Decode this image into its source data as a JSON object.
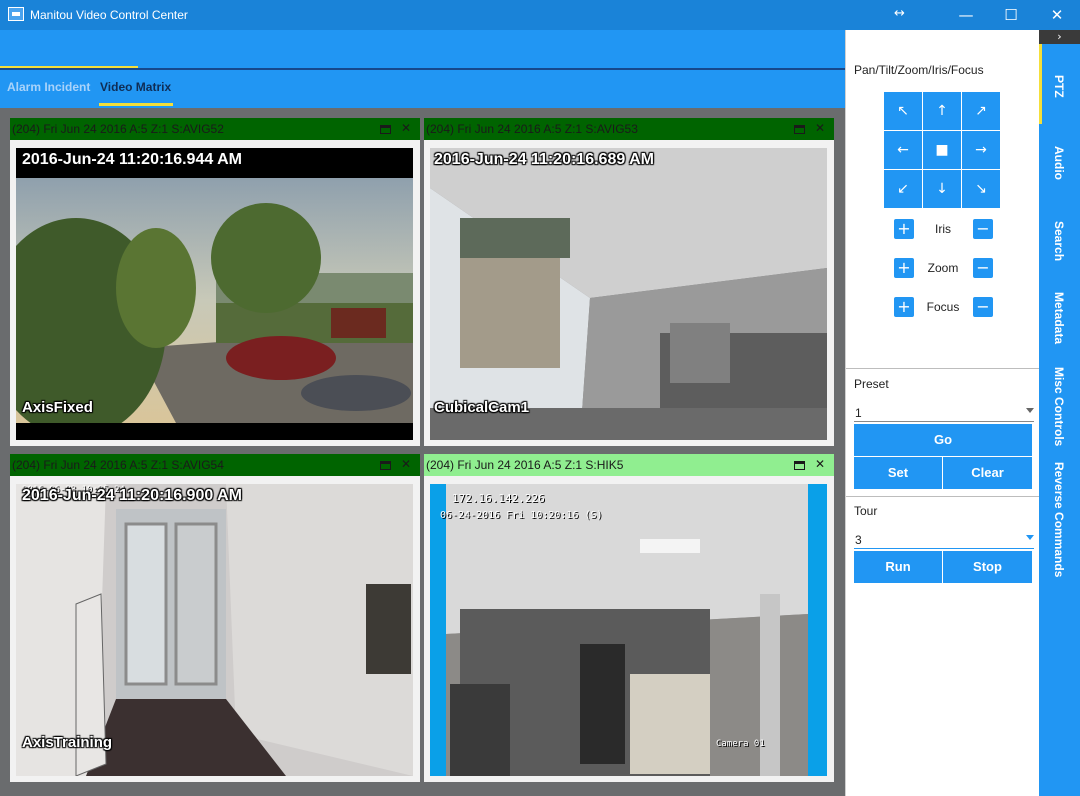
{
  "window": {
    "title": "Manitou Video Control Center",
    "controls": {
      "resize": "↔",
      "minimize": "—",
      "maximize": "☐",
      "close": "✕"
    }
  },
  "tabs": [
    {
      "label": "Alarm Incident",
      "active": false
    },
    {
      "label": "Video Matrix",
      "active": true
    }
  ],
  "cameras": [
    {
      "header": "(204) Fri Jun 24 2016 A:5 Z:1 S:AVIG52",
      "timestamp": "2016-Jun-24 11:20:16.944 AM",
      "name": "AxisFixed",
      "header_color": "#006400"
    },
    {
      "header": "(204) Fri Jun 24 2016 A:5 Z:1 S:AVIG53",
      "timestamp": "2016-Jun-24 11:20:16.689 AM",
      "name": "CubicalCam1",
      "header_color": "#006400"
    },
    {
      "header": "(204) Fri Jun 24 2016 A:5 Z:1 S:AVIG54",
      "timestamp": "2016-Jun-24 11:20:16.900 AM",
      "name": "AxisTraining",
      "header_color": "#006400"
    },
    {
      "header": "(204) Fri Jun 24 2016 A:5 Z:1 S:HIK5",
      "ip": "172.16.142.226",
      "overlay_time": "06-24-2016 Fri 10:20:16 (S)",
      "name": "Camera 01",
      "header_color": "#90ee90"
    }
  ],
  "panel_icons": {
    "maximize": "maximize-icon",
    "close": "✕"
  },
  "ptz": {
    "title": "Pan/Tilt/Zoom/Iris/Focus",
    "arrows": [
      "↖",
      "↑",
      "↗",
      "←",
      "■",
      "→",
      "↙",
      "↓",
      "↘"
    ],
    "controls": [
      {
        "label": "Iris",
        "plus": "+",
        "minus": "−"
      },
      {
        "label": "Zoom",
        "plus": "+",
        "minus": "−"
      },
      {
        "label": "Focus",
        "plus": "+",
        "minus": "−"
      }
    ]
  },
  "preset": {
    "label": "Preset",
    "value": "1",
    "go": "Go",
    "set": "Set",
    "clear": "Clear"
  },
  "tour": {
    "label": "Tour",
    "value": "3",
    "run": "Run",
    "stop": "Stop"
  },
  "side_tabs": {
    "collapse": "›",
    "items": [
      "PTZ",
      "Audio",
      "Search",
      "Metadata",
      "Misc Controls",
      "Reverse Commands"
    ]
  },
  "colors": {
    "accent": "#2196f3",
    "tab_highlight": "#f4df3a",
    "panel_header_green": "#006400",
    "panel_header_light": "#90ee90"
  }
}
